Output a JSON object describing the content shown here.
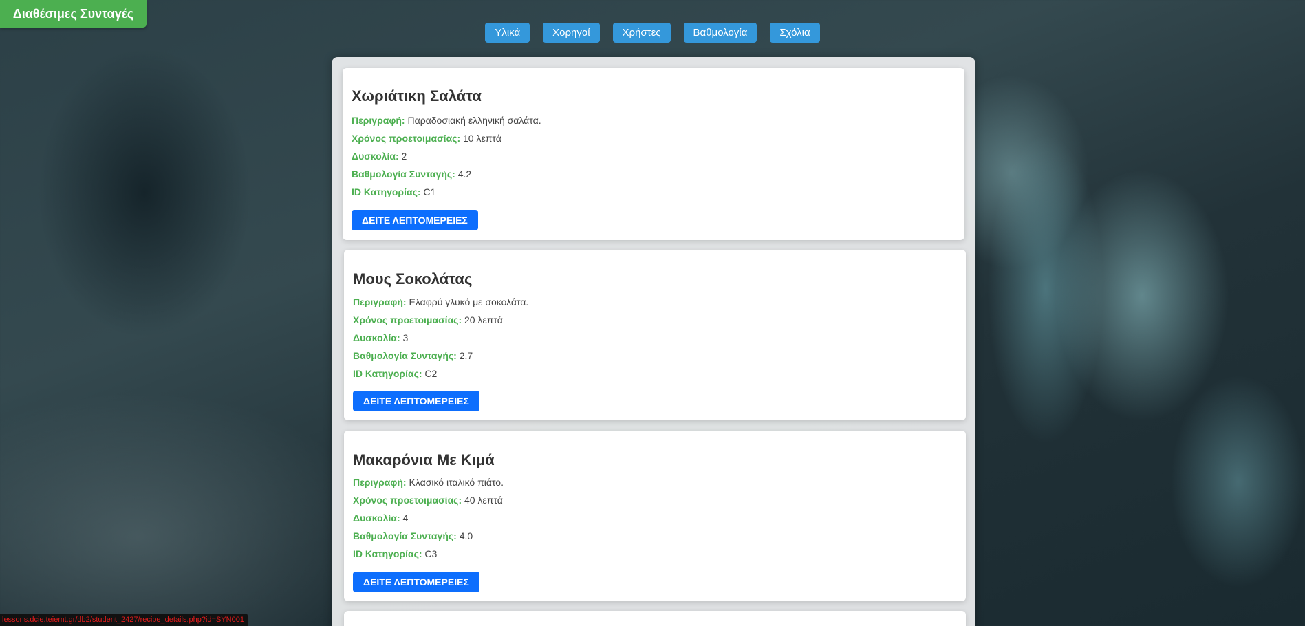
{
  "header": {
    "brand": "Διαθέσιμες Συνταγές"
  },
  "nav": [
    "Υλικά",
    "Χορηγοί",
    "Χρήστες",
    "Βαθμολογία",
    "Σχόλια"
  ],
  "labels": {
    "description": "Περιγραφή:",
    "prep_time": "Χρόνος προετοιμασίας:",
    "difficulty": "Δυσκολία:",
    "rating": "Βαθμολογία Συνταγής:",
    "category": "ID Κατηγορίας:",
    "details_button": "ΔΕΙΤΕ ΛΕΠΤΟΜΕΡΕΙΕΣ"
  },
  "recipes": [
    {
      "title": "Χωριάτικη Σαλάτα",
      "description": "Παραδοσιακή ελληνική σαλάτα.",
      "prep_time": "10 λεπτά",
      "difficulty": "2",
      "rating": "4.2",
      "category": "C1"
    },
    {
      "title": "Μους Σοκολάτας",
      "description": "Ελαφρύ γλυκό με σοκολάτα.",
      "prep_time": "20 λεπτά",
      "difficulty": "3",
      "rating": "2.7",
      "category": "C2"
    },
    {
      "title": "Μακαρόνια Με Κιμά",
      "description": "Κλασικό ιταλικό πιάτο.",
      "prep_time": "40 λεπτά",
      "difficulty": "4",
      "rating": "4.0",
      "category": "C3"
    }
  ],
  "status_bar": {
    "url": "lessons.dcie.teiemt.gr/db2/student_2427/recipe_details.php?id=SYN001"
  },
  "colors": {
    "brand": "#4caf50",
    "nav": "#3498db",
    "details_button": "#0d6efd",
    "label": "#4caf50"
  }
}
